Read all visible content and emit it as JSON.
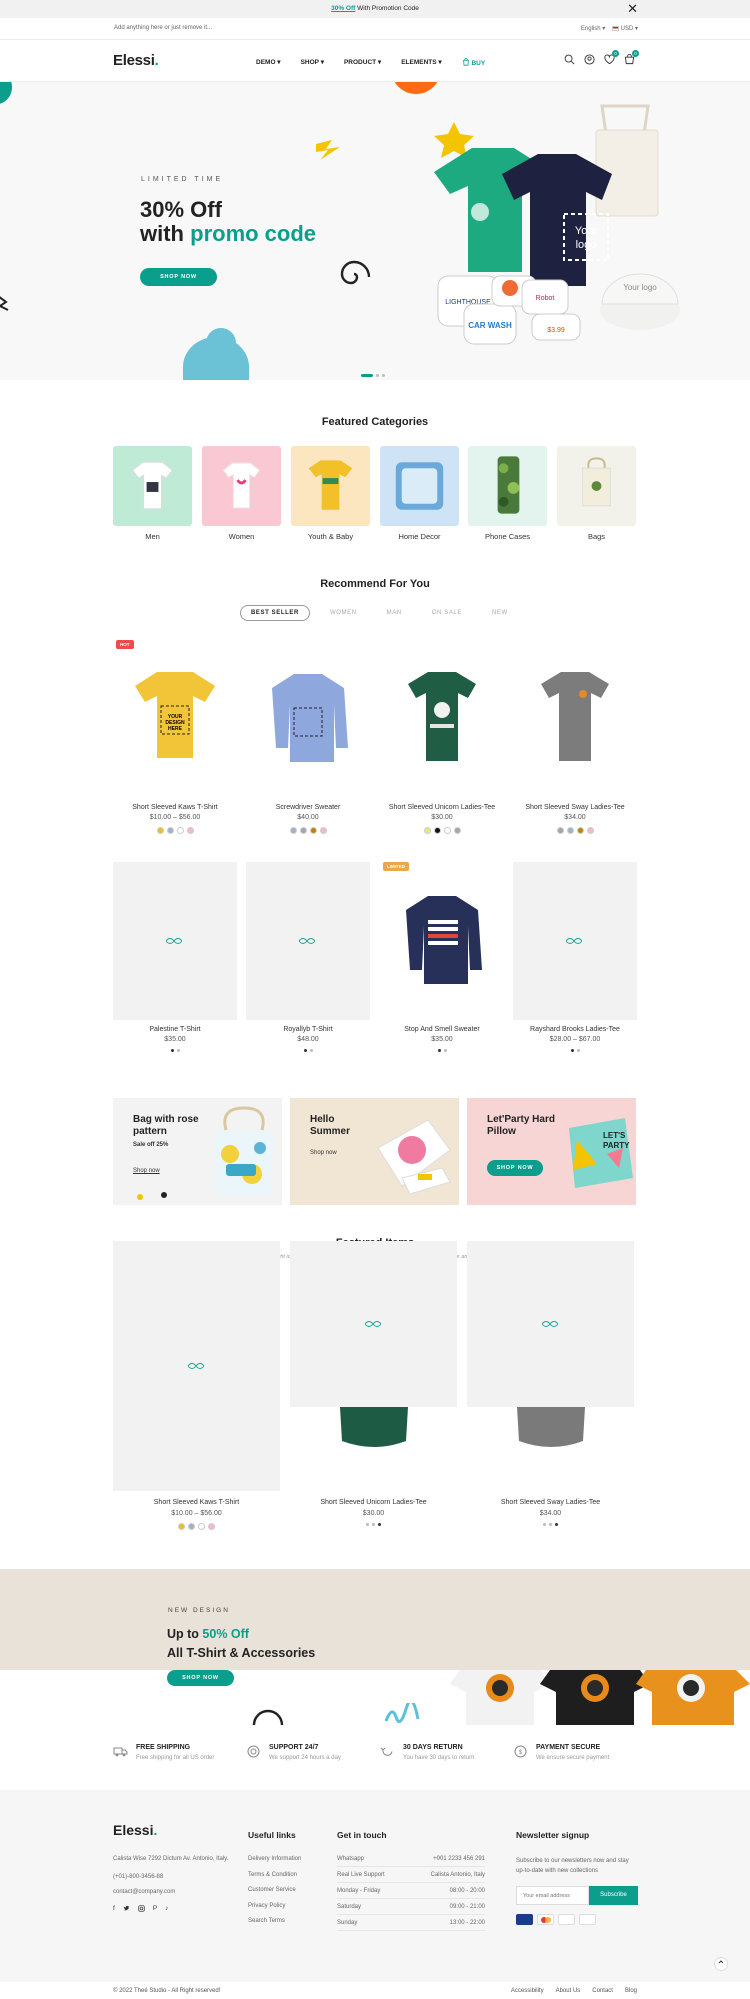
{
  "promo_bar": {
    "link": "30% Off",
    "text": "With Promotion Code",
    "close": "✕"
  },
  "util_bar": {
    "left": "Add anything here or just remove it...",
    "language": "English",
    "currency": "USD"
  },
  "header": {
    "logo": "Elessi",
    "logo_dot": ".",
    "menu": [
      "DEMO",
      "SHOP",
      "PRODUCT",
      "ELEMENTS"
    ],
    "buy": "BUY",
    "wishlist_count": "0",
    "cart_count": "0"
  },
  "hero": {
    "eyebrow": "LIMITED TIME",
    "line1": "30% Off",
    "line2_pre": "with",
    "line2_accent": "promo code",
    "cta": "SHOP NOW",
    "slide_dots": 3
  },
  "featured_categories": {
    "title": "Featured Categories",
    "items": [
      {
        "label": "Men",
        "bg": "#bfead6"
      },
      {
        "label": "Women",
        "bg": "#f9c8d3"
      },
      {
        "label": "Youth & Baby",
        "bg": "#fbe6c0"
      },
      {
        "label": "Home Decor",
        "bg": "#cfe3f6"
      },
      {
        "label": "Phone Cases",
        "bg": "#e3f3ed"
      },
      {
        "label": "Bags",
        "bg": "#f2f2ea"
      }
    ]
  },
  "recommend": {
    "title": "Recommend For You",
    "tabs": [
      "BEST SELLER",
      "WOMEN",
      "MAN",
      "ON SALE",
      "NEW"
    ],
    "products": [
      {
        "name": "Short Sleeved Kaws T-Shirt",
        "price": "$10.00 – $56.00",
        "badge": "HOT",
        "swatches": [
          "#e6c12a",
          "#9fb3c8",
          "#ffffff",
          "#f6b7c8"
        ],
        "img": "yellow-tshirt"
      },
      {
        "name": "Screwdriver Sweater",
        "price": "$40.00",
        "badge": "",
        "swatches": [
          "#9fb3c8",
          "#a5a5a5",
          "#b8860b",
          "#f6b7c8"
        ],
        "img": "blue-sweater"
      },
      {
        "name": "Short Sleeved Unicorn Ladies-Tee",
        "price": "$30.00",
        "badge": "",
        "swatches": [
          "#e5e87a",
          "#111111",
          "#ffffff",
          "#a5a5a5"
        ],
        "img": "green-tee"
      },
      {
        "name": "Short Sleeved Sway Ladies-Tee",
        "price": "$34.00",
        "badge": "",
        "swatches": [
          "#a5a5a5",
          "#9fb3c8",
          "#b8860b",
          "#f6b7c8"
        ],
        "img": "gray-tee"
      },
      {
        "name": "Palestine T-Shirt",
        "price": "$35.00",
        "badge": "",
        "swatches": [],
        "img": "placeholder"
      },
      {
        "name": "Royallyb T-Shirt",
        "price": "$48.00",
        "badge": "",
        "swatches": [],
        "img": "placeholder"
      },
      {
        "name": "Stop And Smell Sweater",
        "price": "$35.00",
        "badge": "LIMITED",
        "swatches": [],
        "img": "navy-sweater"
      },
      {
        "name": "Rayshard Brooks Ladies-Tee",
        "price": "$28.00 – $67.00",
        "badge": "",
        "swatches": [],
        "img": "placeholder"
      }
    ]
  },
  "banners": [
    {
      "title": "Bag with rose pattern",
      "sub": "Sale off 25%",
      "link": "Shop now",
      "bg": "#f3f3f3"
    },
    {
      "title": "Hello Summer",
      "link": "Shop now",
      "bg": "#f1e6d4"
    },
    {
      "title": "Let'Party Hard Pillow",
      "cta": "SHOP NOW",
      "bg": "#f7d5d4"
    }
  ],
  "featured_items": {
    "title": "Featured Items",
    "subtitle": "Find a bright ideal to suit your taste with our great selection of suspension, wall, floor and table light",
    "items": [
      {
        "name": "Short Sleeved Kaws T-Shirt",
        "price": "$10.00 – $56.00",
        "swatches": [
          "#e6c12a",
          "#9fb3c8",
          "#ffffff",
          "#f6b7c8"
        ]
      },
      {
        "name": "Short Sleeved Unicorn Ladies-Tee",
        "price": "$30.00",
        "swatches": []
      },
      {
        "name": "Short Sleeved Sway Ladies-Tee",
        "price": "$34.00",
        "swatches": []
      }
    ]
  },
  "promo_banner": {
    "eyebrow": "NEW DESIGN",
    "line1_pre": "Up to",
    "line1_accent": "50% Off",
    "line2": "All T-Shirt & Accessories",
    "cta": "SHOP NOW"
  },
  "services": [
    {
      "title": "FREE SHIPPING",
      "desc": "Free shipping for all US order",
      "icon": "truck-icon"
    },
    {
      "title": "SUPPORT 24/7",
      "desc": "We support 24 hours a day",
      "icon": "support-icon"
    },
    {
      "title": "30 DAYS RETURN",
      "desc": "You have 30 days to return",
      "icon": "return-icon"
    },
    {
      "title": "PAYMENT SECURE",
      "desc": "We ensure secure payment",
      "icon": "payment-icon"
    }
  ],
  "footer": {
    "logo": "Elessi",
    "address": "Calista Wise 7292 Dictum Av. Antonio, Italy.",
    "phone": "(+01)-800-3456-88",
    "email": "contact@company.com",
    "useful_title": "Useful links",
    "useful_links": [
      "Delivery Information",
      "Terms & Condition",
      "Customer Service",
      "Privacy Policy",
      "Search Terms"
    ],
    "touch_title": "Get in touch",
    "touch_rows": [
      {
        "k": "Whatsapp",
        "v": "+001 2233 456 291"
      },
      {
        "k": "Real Live Support",
        "v": "Calista Antonio, Italy"
      },
      {
        "k": "Monday - Friday",
        "v": "08:00 - 20:00"
      },
      {
        "k": "Saturday",
        "v": "09:00 - 21:00"
      },
      {
        "k": "Sunday",
        "v": "13:00 - 22:00"
      }
    ],
    "newsletter_title": "Newsletter signup",
    "newsletter_desc": "Subscribe to our newsletters now and stay up-to-date with new collections",
    "email_placeholder": "Your email address",
    "subscribe": "Subscribe",
    "copyright": "© 2022 Theé Studio - All Right reserved!",
    "bottom_links": [
      "Accessibility",
      "About Us",
      "Contact",
      "Blog"
    ]
  }
}
